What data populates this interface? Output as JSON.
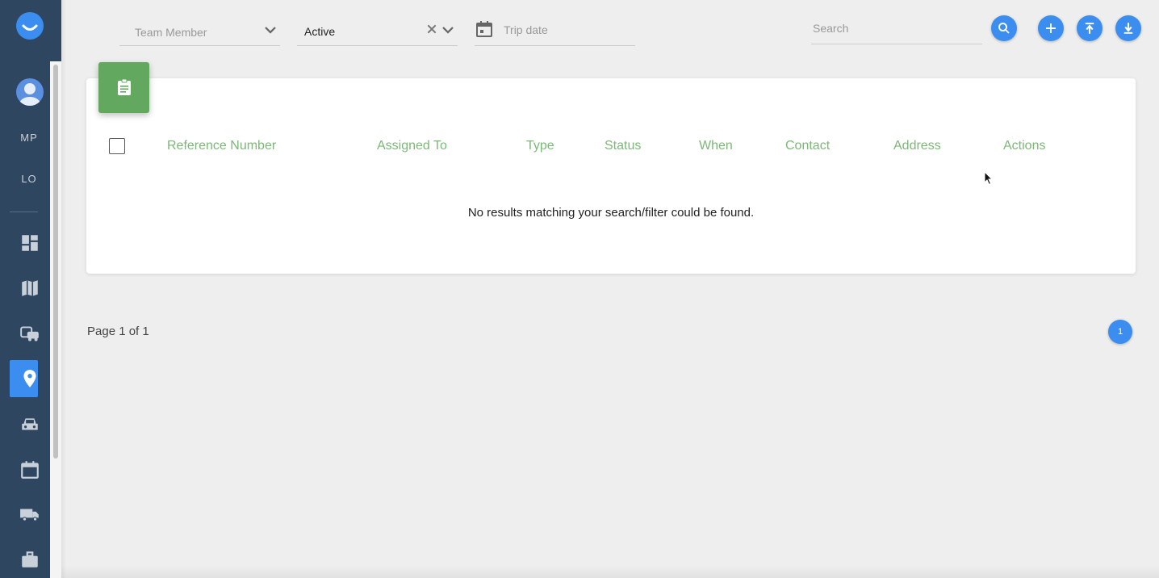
{
  "sidebar": {
    "initials": [
      "MP",
      "LO"
    ],
    "nav_icons": [
      "dashboard-icon",
      "map-icon",
      "vehicles-icon",
      "location-pin-icon",
      "car-icon",
      "calendar-icon",
      "truck-icon",
      "briefcase-icon"
    ],
    "active_item": "location-pin-icon"
  },
  "filters": {
    "team_member_placeholder": "Team Member",
    "status_value": "Active",
    "trip_date_placeholder": "Trip date",
    "search_placeholder": "Search"
  },
  "toolbar": {
    "buttons": [
      "search-icon",
      "add-icon",
      "upload-icon",
      "download-icon"
    ]
  },
  "table": {
    "columns": [
      "Reference Number",
      "Assigned To",
      "Type",
      "Status",
      "When",
      "Contact",
      "Address",
      "Actions"
    ],
    "empty_message": "No results matching your search/filter could be found."
  },
  "pagination": {
    "info": "Page 1 of 1",
    "current_page": "1"
  },
  "colors": {
    "sidebar": "#2f4661",
    "accent": "#3b8ef0",
    "header_green": "#7cb877",
    "card_icon_green": "#62a95f"
  }
}
